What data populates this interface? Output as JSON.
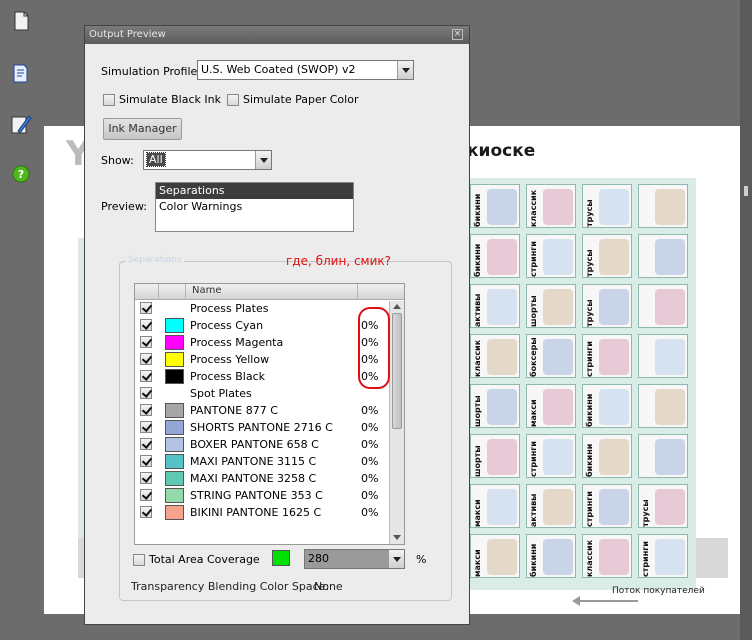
{
  "dialog": {
    "title": "Output Preview",
    "close_glyph": "×",
    "simulation_profile_label": "Simulation Profile:",
    "simulation_profile_value": "U.S. Web Coated (SWOP) v2",
    "simulate_black_ink_label": "Simulate Black Ink",
    "simulate_paper_color_label": "Simulate Paper Color",
    "ink_manager_label": "Ink Manager",
    "show_label": "Show:",
    "show_value": "All",
    "preview_label": "Preview:",
    "preview_options": [
      "Separations",
      "Color Warnings"
    ],
    "preview_selected": "Separations",
    "group_label": "Separations",
    "name_column_header": "Name",
    "separations": [
      {
        "name": "Process Plates",
        "checked": true,
        "color": null,
        "percent": ""
      },
      {
        "name": "Process Cyan",
        "checked": true,
        "color": "#00ffff",
        "percent": "0%"
      },
      {
        "name": "Process Magenta",
        "checked": true,
        "color": "#ff00ff",
        "percent": "0%"
      },
      {
        "name": "Process Yellow",
        "checked": true,
        "color": "#ffff00",
        "percent": "0%"
      },
      {
        "name": "Process Black",
        "checked": true,
        "color": "#000000",
        "percent": "0%"
      },
      {
        "name": "Spot Plates",
        "checked": true,
        "color": null,
        "percent": ""
      },
      {
        "name": "PANTONE 877 C",
        "checked": true,
        "color": "#a6a6a6",
        "percent": "0%"
      },
      {
        "name": "SHORTS PANTONE 2716 C",
        "checked": true,
        "color": "#94a6d6",
        "percent": "0%"
      },
      {
        "name": "BOXER PANTONE 658 C",
        "checked": true,
        "color": "#b3c4e3",
        "percent": "0%"
      },
      {
        "name": "MAXI PANTONE 3115 C",
        "checked": true,
        "color": "#56c2c8",
        "percent": "0%"
      },
      {
        "name": "MAXI PANTONE 3258 C",
        "checked": true,
        "color": "#5fcab4",
        "percent": "0%"
      },
      {
        "name": "STRING PANTONE 353 C",
        "checked": true,
        "color": "#93d9a9",
        "percent": "0%"
      },
      {
        "name": "BIKINI PANTONE 1625 C",
        "checked": true,
        "color": "#f6a28c",
        "percent": "0%"
      }
    ],
    "total_area_coverage_label": "Total Area Coverage",
    "total_area_coverage_color": "#00e000",
    "total_area_coverage_value": "280",
    "percent_sign": "%",
    "blending_label": "Transparency Blending Color Space:",
    "blending_value": "None"
  },
  "annotation": {
    "text": "где, блин, смик?",
    "color": "#e01010"
  },
  "document": {
    "heading": "киоске",
    "ghost_letter": "Y",
    "footer": "Поток покупателей",
    "product_labels": [
      [
        "бикини",
        "классик",
        "трусы",
        ""
      ],
      [
        "бикини",
        "стринги",
        "трусы",
        ""
      ],
      [
        "активы",
        "шорты",
        "трусы",
        ""
      ],
      [
        "классик",
        "боксеры",
        "стринги",
        ""
      ],
      [
        "шорты",
        "макси",
        "бикини",
        ""
      ],
      [
        "шорты",
        "стринги",
        "бикини",
        ""
      ],
      [
        "макси",
        "активы",
        "стринги",
        "трусы"
      ],
      [
        "макси",
        "бикини",
        "классик",
        "стринги"
      ]
    ]
  },
  "toolbar": {
    "icons": [
      "pages-icon",
      "bookmarks-icon",
      "signature-icon",
      "help-icon"
    ]
  }
}
